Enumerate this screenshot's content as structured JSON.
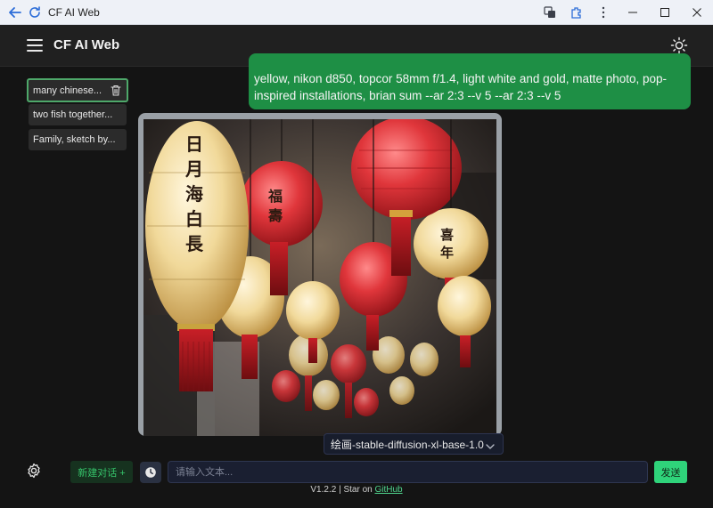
{
  "window": {
    "title": "CF AI Web"
  },
  "app": {
    "title": "CF AI Web"
  },
  "sidebar": {
    "conversations": [
      {
        "label": "many chinese..."
      },
      {
        "label": "two fish together..."
      },
      {
        "label": "Family, sketch by..."
      }
    ]
  },
  "chat": {
    "user_message_visible": "yellow, nikon d850, topcor 58mm f/1.4, light white and gold, matte photo, pop-inspired installations, brian sum --ar 2:3 --v 5 --ar 2:3 --v 5",
    "image_caption_chars": [
      [
        "日",
        "月",
        "海",
        "白",
        "長"
      ],
      [
        "福",
        "壽"
      ],
      [
        "喜",
        "年"
      ]
    ]
  },
  "model_selector": {
    "selected": "绘画-stable-diffusion-xl-base-1.0"
  },
  "input_bar": {
    "new_chat_label": "新建对话 +",
    "placeholder": "请输入文本...",
    "send_label": "发送"
  },
  "footer": {
    "version_text": "V1.2.2 | Star on ",
    "link_text": "GitHub"
  },
  "colors": {
    "accent_green": "#2fd37a",
    "user_bubble": "#1e8f45",
    "header_bg": "#202020",
    "page_bg": "#141414"
  }
}
